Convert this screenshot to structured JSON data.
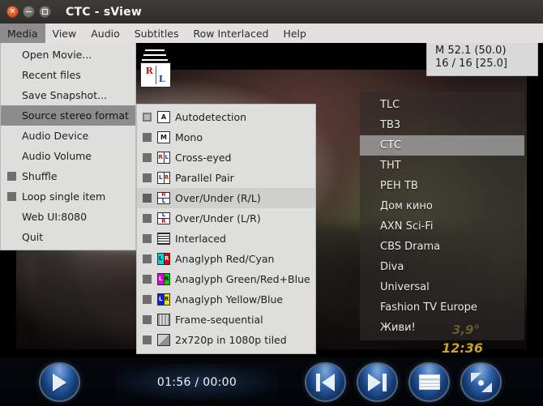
{
  "window": {
    "title": "CTC - sView",
    "buttons": {
      "close": "close",
      "minimize": "minimize",
      "maximize": "maximize"
    }
  },
  "menubar": {
    "items": [
      {
        "label": "Media",
        "active": true
      },
      {
        "label": "View",
        "active": false
      },
      {
        "label": "Audio",
        "active": false
      },
      {
        "label": "Subtitles",
        "active": false
      },
      {
        "label": "Row Interlaced",
        "active": false
      },
      {
        "label": "Help",
        "active": false
      }
    ]
  },
  "media_menu": {
    "items": [
      {
        "label": "Open Movie...",
        "checkbox": false,
        "selected": false
      },
      {
        "label": "Recent files",
        "checkbox": false,
        "selected": false
      },
      {
        "label": "Save Snapshot...",
        "checkbox": false,
        "selected": false
      },
      {
        "label": "Source stereo format",
        "checkbox": false,
        "selected": true
      },
      {
        "label": "Audio Device",
        "checkbox": false,
        "selected": false
      },
      {
        "label": "Audio Volume",
        "checkbox": false,
        "selected": false
      },
      {
        "label": "Shuffle",
        "checkbox": true,
        "selected": false
      },
      {
        "label": "Loop single item",
        "checkbox": true,
        "selected": false
      },
      {
        "label": "Web UI:8080",
        "checkbox": false,
        "selected": false
      },
      {
        "label": "Quit",
        "checkbox": false,
        "selected": false
      }
    ]
  },
  "stereo_submenu": {
    "items": [
      {
        "label": "Autodetection",
        "icon": "autodetect-icon",
        "icon_text": "A",
        "selected": false,
        "radio": true
      },
      {
        "label": "Mono",
        "icon": "mono-icon",
        "icon_text": "M",
        "selected": false,
        "radio": false
      },
      {
        "label": "Cross-eyed",
        "icon": "cross-eyed-icon",
        "icon_text": "R|L",
        "selected": false,
        "radio": false
      },
      {
        "label": "Parallel Pair",
        "icon": "parallel-pair-icon",
        "icon_text": "L|R",
        "selected": false,
        "radio": false
      },
      {
        "label": "Over/Under (R/L)",
        "icon": "over-under-rl-icon",
        "icon_text": "R/L",
        "selected": true,
        "radio": false
      },
      {
        "label": "Over/Under (L/R)",
        "icon": "over-under-lr-icon",
        "icon_text": "L/R",
        "selected": false,
        "radio": false
      },
      {
        "label": "Interlaced",
        "icon": "interlaced-icon",
        "icon_text": "",
        "selected": false,
        "radio": false
      },
      {
        "label": "Anaglyph Red/Cyan",
        "icon": "anaglyph-red-cyan-icon",
        "icon_text": "L R",
        "selected": false,
        "radio": false
      },
      {
        "label": "Anaglyph Green/Red+Blue",
        "icon": "anaglyph-green-redblue-icon",
        "icon_text": "L R",
        "selected": false,
        "radio": false
      },
      {
        "label": "Anaglyph Yellow/Blue",
        "icon": "anaglyph-yellow-blue-icon",
        "icon_text": "L R",
        "selected": false,
        "radio": false
      },
      {
        "label": "Frame-sequential",
        "icon": "frame-sequential-icon",
        "icon_text": "",
        "selected": false,
        "radio": false
      },
      {
        "label": "2x720p in 1080p tiled",
        "icon": "tiled-720p-icon",
        "icon_text": "",
        "selected": false,
        "radio": false
      }
    ],
    "colors": {
      "red": "#e00000",
      "cyan": "#00d8d8",
      "green": "#00d000",
      "magenta": "#e000e0",
      "yellow": "#e8e800",
      "blue": "#1020e0"
    }
  },
  "channel_list": {
    "items": [
      {
        "label": "TLC",
        "selected": false
      },
      {
        "label": "ТВ3",
        "selected": false
      },
      {
        "label": "СТС",
        "selected": true
      },
      {
        "label": "ТНТ",
        "selected": false
      },
      {
        "label": "РЕН ТВ",
        "selected": false
      },
      {
        "label": "Дом кино",
        "selected": false
      },
      {
        "label": "AXN Sci-Fi",
        "selected": false
      },
      {
        "label": "CBS Drama",
        "selected": false
      },
      {
        "label": "Diva",
        "selected": false
      },
      {
        "label": "Universal",
        "selected": false
      },
      {
        "label": "Fashion TV Europe",
        "selected": false
      },
      {
        "label": "Живи!",
        "selected": false
      }
    ]
  },
  "video_overlay": {
    "info_line1": "M 52.1 (50.0)",
    "info_line2": "16 / 16 [25.0]",
    "stereo_icon_left": "R",
    "stereo_icon_right": "L",
    "osd_temperature": "3,9°",
    "osd_clock": "12:36"
  },
  "controls": {
    "play_label": "play",
    "time_display": "01:56 / 00:00",
    "prev_label": "previous",
    "next_label": "next",
    "playlist_label": "playlist",
    "fx_label": "stereo-effects"
  }
}
